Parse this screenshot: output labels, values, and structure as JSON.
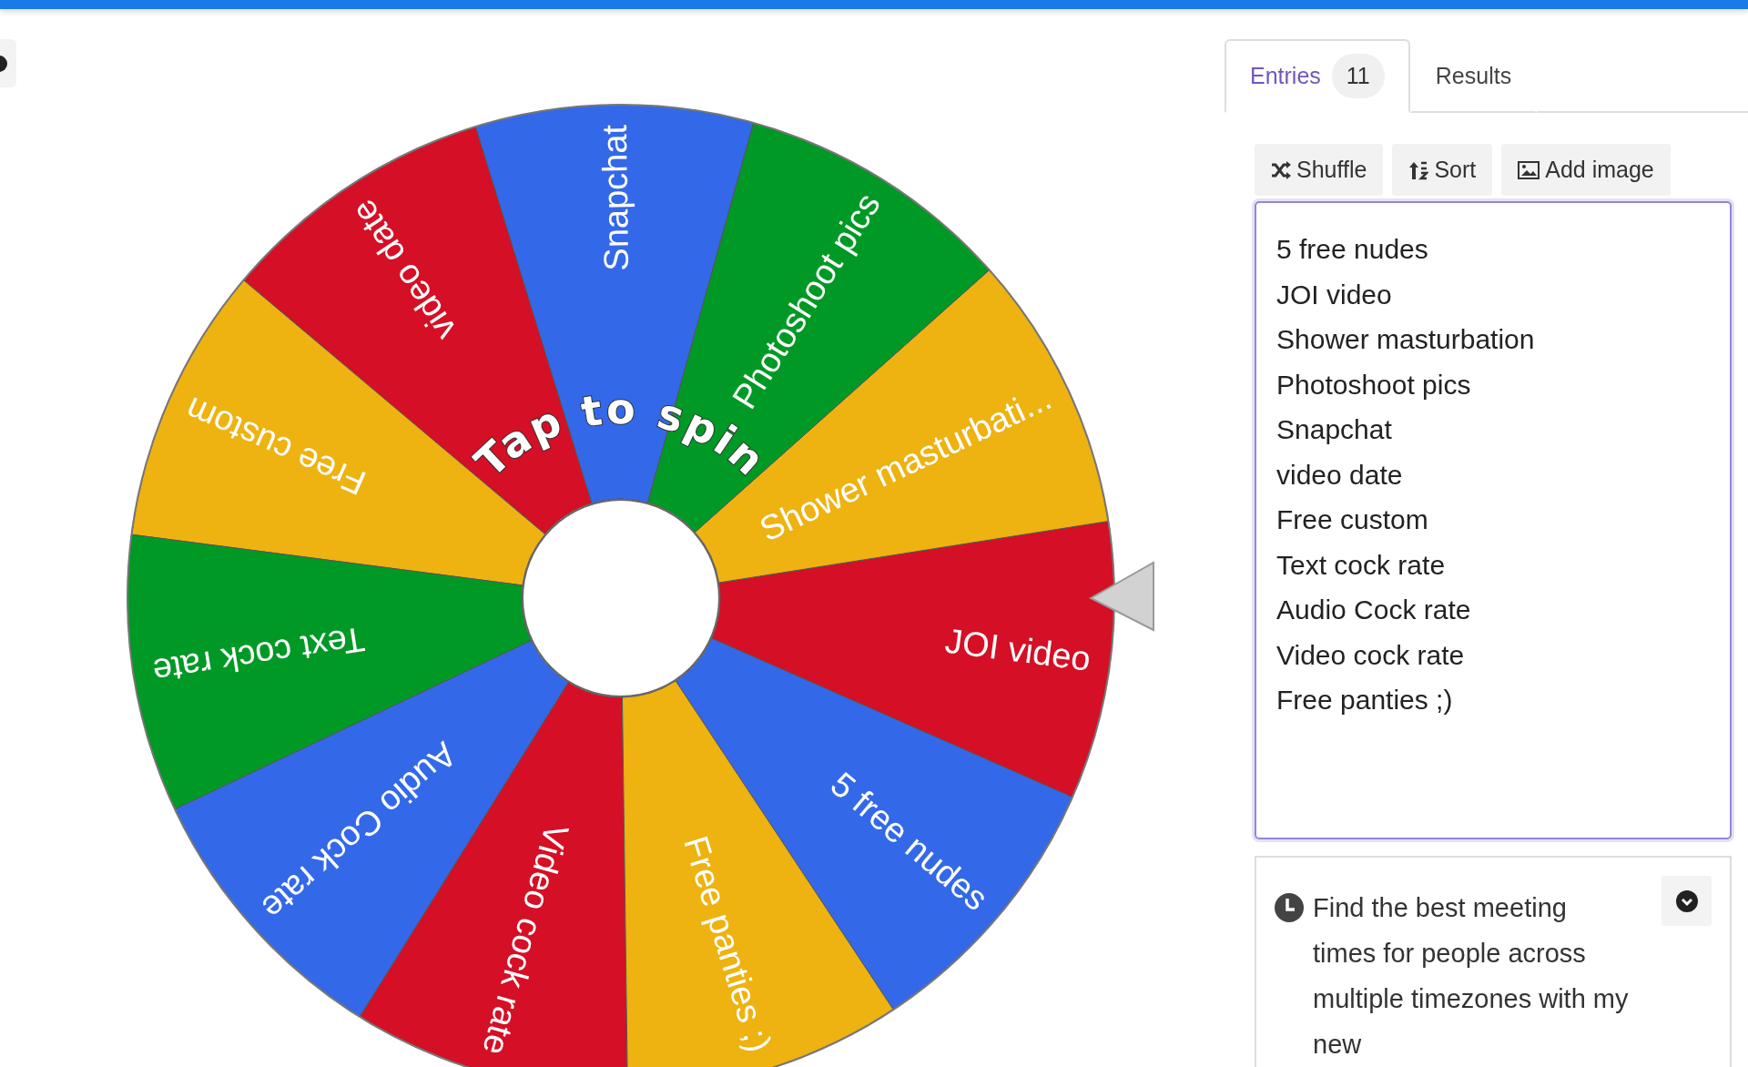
{
  "wheel": {
    "center_label": "Tap to spin",
    "slices": [
      {
        "label": "5 free nudes",
        "color": "#3369e8"
      },
      {
        "label": "JOI video",
        "color": "#d50f25"
      },
      {
        "label": "Shower masturbati...",
        "color": "#eeb211"
      },
      {
        "label": "Photoshoot pics",
        "color": "#009925"
      },
      {
        "label": "Snapchat",
        "color": "#3369e8"
      },
      {
        "label": "video date",
        "color": "#d50f25"
      },
      {
        "label": "Free custom",
        "color": "#eeb211"
      },
      {
        "label": "Text cock rate",
        "color": "#009925"
      },
      {
        "label": "Audio Cock rate",
        "color": "#3369e8"
      },
      {
        "label": "Video cock rate",
        "color": "#d50f25"
      },
      {
        "label": "Free panties ;)",
        "color": "#eeb211"
      }
    ]
  },
  "tabs": [
    {
      "label": "Entries",
      "badge": "11",
      "selected": true
    },
    {
      "label": "Results",
      "selected": false
    }
  ],
  "toolbar": [
    {
      "kind": "shuffle",
      "label": "Shuffle"
    },
    {
      "kind": "sort",
      "label": "Sort"
    },
    {
      "kind": "image",
      "label": "Add image"
    }
  ],
  "entries": [
    "5 free nudes",
    "JOI video",
    "Shower masturbation",
    "Photoshoot pics",
    "Snapchat",
    "video date",
    "Free custom",
    "Text cock rate",
    "Audio Cock rate",
    "Video cock rate",
    "Free panties ;)"
  ],
  "info_card": {
    "text": "Find the best meeting times for people across multiple timezones with my new"
  }
}
